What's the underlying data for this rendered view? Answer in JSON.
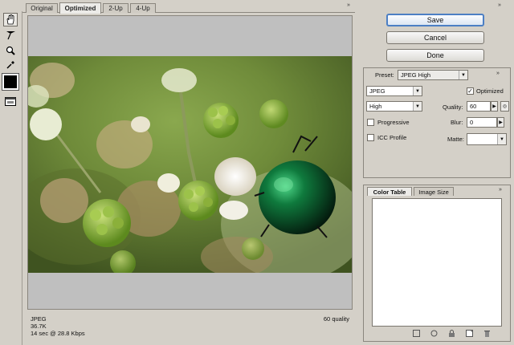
{
  "tabs": [
    {
      "label": "Original"
    },
    {
      "label": "Optimized"
    },
    {
      "label": "2-Up"
    },
    {
      "label": "4-Up"
    }
  ],
  "panel_collapse": "»",
  "status": {
    "format": "JPEG",
    "size": "36.7K",
    "time": "14 sec @ 28.8 Kbps",
    "quality": "60 quality"
  },
  "buttons": {
    "save": "Save",
    "cancel": "Cancel",
    "done": "Done"
  },
  "settings": {
    "preset_label": "Preset:",
    "preset_value": "JPEG High",
    "format_value": "JPEG",
    "optimized_label": "Optimized",
    "optimized_checked": true,
    "quality_name_value": "High",
    "quality_label": "Quality:",
    "quality_value": "60",
    "progressive_label": "Progressive",
    "progressive_checked": false,
    "blur_label": "Blur:",
    "blur_value": "0",
    "icc_label": "ICC Profile",
    "icc_checked": false,
    "matte_label": "Matte:"
  },
  "color_panel": {
    "tabs": [
      {
        "label": "Color Table"
      },
      {
        "label": "Image Size"
      }
    ]
  },
  "icons": {
    "hand": "hand-tool-icon",
    "slice": "slice-select-icon",
    "zoom": "zoom-icon",
    "eyedropper": "eyedropper-icon",
    "preview": "browser-preview-icon"
  }
}
